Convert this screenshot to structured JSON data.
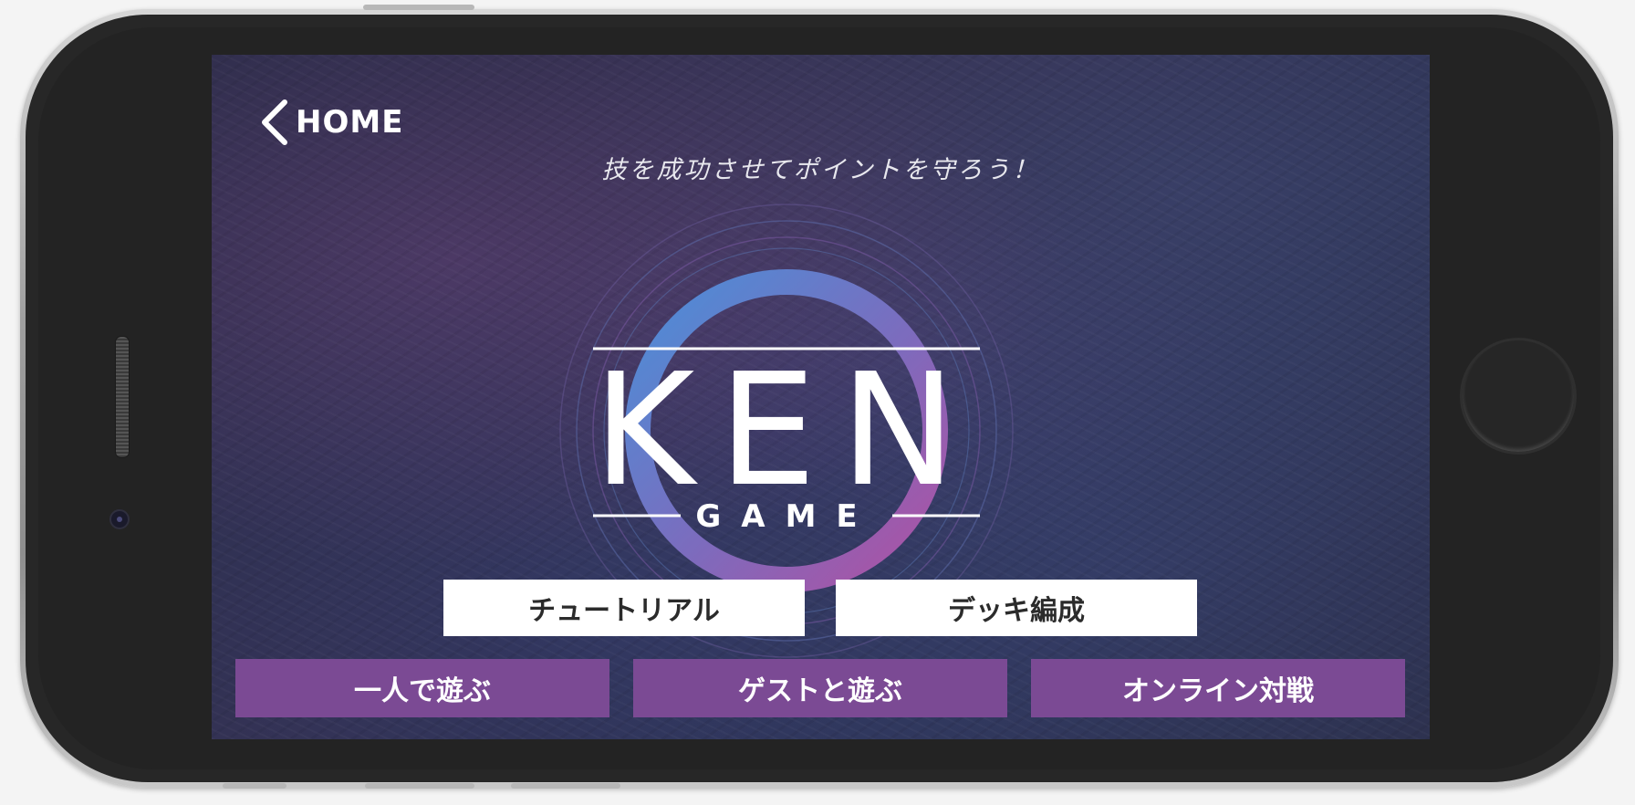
{
  "nav": {
    "back_label": "HOME"
  },
  "hero": {
    "tagline": "技を成功させてポイントを守ろう！",
    "logo_title": "KEN",
    "logo_subtitle": "GAME"
  },
  "menu": {
    "secondary": [
      {
        "label": "チュートリアル"
      },
      {
        "label": "デッキ編成"
      }
    ],
    "primary": [
      {
        "label": "一人で遊ぶ"
      },
      {
        "label": "ゲストと遊ぶ"
      },
      {
        "label": "オンライン対戦"
      }
    ]
  },
  "colors": {
    "primary_button": "#7b4a94",
    "secondary_button": "#ffffff",
    "ring_start": "#4a8fd8",
    "ring_end": "#a24fa6"
  },
  "icons": {
    "back": "chevron-left-icon"
  }
}
